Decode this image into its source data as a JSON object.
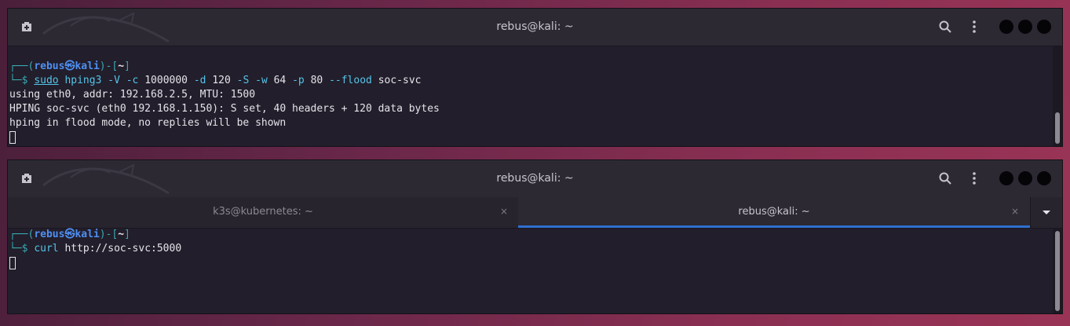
{
  "window_top": {
    "title": "rebus@kali: ~",
    "terminal": {
      "prompt_open": "┌──(",
      "prompt_user": "rebus",
      "prompt_at": "㉿",
      "prompt_host": "kali",
      "prompt_mid": ")-[",
      "prompt_dir": "~",
      "prompt_close": "]",
      "prompt_line2": "└─$ ",
      "cmd_sudo": "sudo",
      "cmd_tool": "hping3",
      "cmd_flag_V": "-V",
      "cmd_flag_c": "-c",
      "cmd_count": "1000000",
      "cmd_flag_d": "-d",
      "cmd_data": "120",
      "cmd_flag_S": "-S",
      "cmd_flag_w": "-w",
      "cmd_win": "64",
      "cmd_flag_p": "-p",
      "cmd_port": "80",
      "cmd_flood": "--flood",
      "cmd_target": "soc-svc",
      "output_1": "using eth0, addr: 192.168.2.5, MTU: 1500",
      "output_2": "HPING soc-svc (eth0 192.168.1.150): S set, 40 headers + 120 data bytes",
      "output_3": "hping in flood mode, no replies will be shown"
    }
  },
  "window_bottom": {
    "title": "rebus@kali: ~",
    "tabs": [
      {
        "label": "k3s@kubernetes: ~",
        "close": "×"
      },
      {
        "label": "rebus@kali: ~",
        "close": "×"
      }
    ],
    "terminal": {
      "prompt_open": "┌──(",
      "prompt_user": "rebus",
      "prompt_at": "㉿",
      "prompt_host": "kali",
      "prompt_mid": ")-[",
      "prompt_dir": "~",
      "prompt_close": "]",
      "prompt_line2": "└─$ ",
      "cmd_tool": "curl",
      "cmd_arg": "http://soc-svc:5000"
    }
  },
  "colors": {
    "prompt_blue": "#4f8ff0",
    "command_cyan": "#55c4e9",
    "active_tab_underline": "#2f6fcf",
    "terminal_bg": "#221e2b"
  }
}
